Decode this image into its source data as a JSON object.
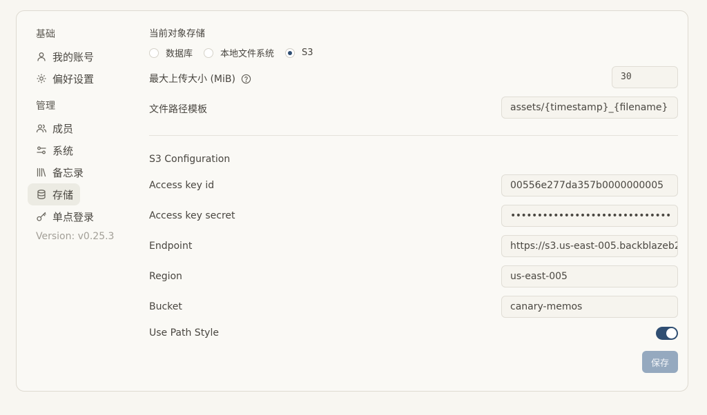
{
  "sidebar": {
    "groups": [
      {
        "label": "基础"
      },
      {
        "label": "管理"
      }
    ],
    "items": [
      {
        "label": "我的账号",
        "icon": "user-icon"
      },
      {
        "label": "偏好设置",
        "icon": "gear-icon"
      },
      {
        "label": "成员",
        "icon": "users-icon"
      },
      {
        "label": "系统",
        "icon": "sliders-icon"
      },
      {
        "label": "备忘录",
        "icon": "library-icon"
      },
      {
        "label": "存储",
        "icon": "database-icon",
        "active": true
      },
      {
        "label": "单点登录",
        "icon": "key-icon"
      }
    ],
    "version": "Version: v0.25.3"
  },
  "storage": {
    "title": "当前对象存储",
    "options": [
      {
        "label": "数据库",
        "checked": false
      },
      {
        "label": "本地文件系统",
        "checked": false
      },
      {
        "label": "S3",
        "checked": true
      }
    ],
    "max_upload_label": "最大上传大小 (MiB)",
    "max_upload_value": "30",
    "path_template_label": "文件路径模板",
    "path_template_value": "assets/{timestamp}_{filename}"
  },
  "s3": {
    "title": "S3 Configuration",
    "fields": [
      {
        "label": "Access key id",
        "value": "00556e277da357b0000000005"
      },
      {
        "label": "Access key secret",
        "value": "••••••••••••••••••••••••••••••"
      },
      {
        "label": "Endpoint",
        "value": "https://s3.us-east-005.backblazeb2"
      },
      {
        "label": "Region",
        "value": "us-east-005"
      },
      {
        "label": "Bucket",
        "value": "canary-memos"
      }
    ],
    "path_style_label": "Use Path Style",
    "path_style_enabled": true,
    "save_label": "保存"
  },
  "colors": {
    "accent": "#2f4e72",
    "save_button": "#95a9bf",
    "background": "#f8f6f1"
  }
}
